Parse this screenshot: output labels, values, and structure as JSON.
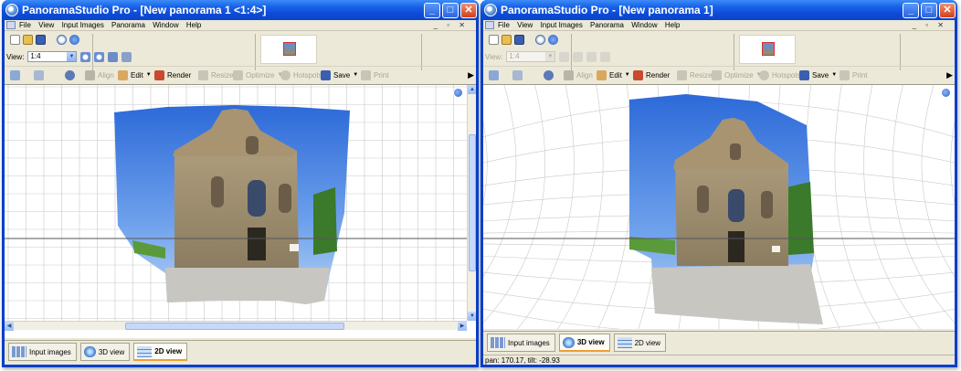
{
  "colors": {
    "title_bar": "#0d4ad6",
    "panel_bg": "#ece9d8",
    "canvas_bg": "#ffffff",
    "grid": "#c9c9c9",
    "horizon": "#555555"
  },
  "windows": [
    {
      "title": "PanoramaStudio Pro - [New panorama 1 <1:4>]",
      "menu": [
        "File",
        "View",
        "Input Images",
        "Panorama",
        "Window",
        "Help"
      ],
      "view_label": "View:",
      "view_value": "1:4",
      "view_enabled": true,
      "toolbar": {
        "align": "Align",
        "edit": "Edit",
        "render": "Render",
        "resize": "Resize",
        "optimize": "Optimize",
        "hotspots": "Hotspots",
        "save": "Save",
        "print": "Print"
      },
      "tabs": [
        {
          "label": "Input images",
          "active": false,
          "icon": "thumbnails-icon"
        },
        {
          "label": "3D view",
          "active": false,
          "icon": "globe-icon"
        },
        {
          "label": "2D view",
          "active": true,
          "icon": "grid-icon"
        }
      ],
      "status": ""
    },
    {
      "title": "PanoramaStudio Pro - [New panorama 1]",
      "menu": [
        "File",
        "View",
        "Input Images",
        "Panorama",
        "Window",
        "Help"
      ],
      "view_label": "View:",
      "view_value": "1:4",
      "view_enabled": false,
      "toolbar": {
        "align": "Align",
        "edit": "Edit",
        "render": "Render",
        "resize": "Resize",
        "optimize": "Optimize",
        "hotspots": "Hotspots",
        "save": "Save",
        "print": "Print"
      },
      "tabs": [
        {
          "label": "Input images",
          "active": false,
          "icon": "thumbnails-icon"
        },
        {
          "label": "3D view",
          "active": true,
          "icon": "globe-icon"
        },
        {
          "label": "2D view",
          "active": false,
          "icon": "grid-icon"
        }
      ],
      "status": "pan: 170.17, tilt: -28.93"
    }
  ]
}
